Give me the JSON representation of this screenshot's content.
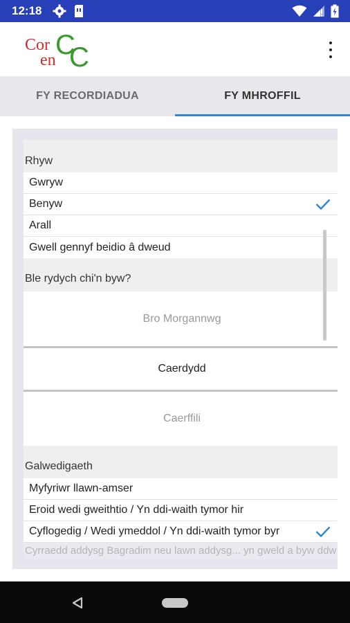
{
  "status_bar": {
    "time": "12:18",
    "icons": [
      "gear-icon",
      "sim-card-icon",
      "wifi-icon",
      "signal-icon",
      "battery-icon"
    ],
    "background": "#2740b8"
  },
  "app_bar": {
    "logo_letters": [
      "Cor",
      "en",
      "C",
      "C"
    ],
    "logo_colors": {
      "red": "#d42a2a",
      "green": "#3a9a2e"
    }
  },
  "tabs": [
    {
      "label": "FY RECORDIADUA",
      "active": false
    },
    {
      "label": "FY MHROFFIL",
      "active": true
    }
  ],
  "accent": "#2f85d6",
  "form": {
    "gender": {
      "heading": "Rhyw",
      "options": [
        "Gwryw",
        "Benyw",
        "Arall",
        "Gwell gennyf beidio â dweud"
      ],
      "selected_index": 1
    },
    "location": {
      "heading": "Ble rydych chi'n byw?",
      "options": [
        "Bro Morgannwg",
        "Caerdydd",
        "Caerffili"
      ],
      "selected_index": 1
    },
    "occupation": {
      "heading": "Galwedigaeth",
      "options": [
        "Myfyriwr llawn-amser",
        "Eroid wedi gweithtio / Yn ddi-waith tymor hir",
        "Cyflogedig / Wedi ymeddol / Yn ddi-waith tymor byr"
      ],
      "selected_index": 2
    },
    "faded_text": "Cyrraedd addysg Bagradim neu lawn addysg... yn gweld a byw ddw"
  }
}
